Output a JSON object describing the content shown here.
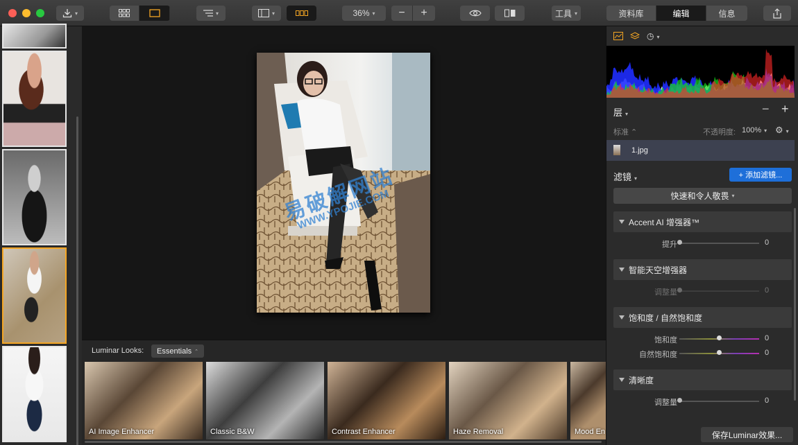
{
  "toolbar": {
    "zoom": "36%",
    "tools_label": "工具",
    "tabs": [
      "资料库",
      "编辑",
      "信息"
    ],
    "active_tab": "编辑"
  },
  "looks": {
    "label": "Luminar Looks:",
    "collection": "Essentials",
    "items": [
      "AI Image Enhancer",
      "Classic B&W",
      "Contrast Enhancer",
      "Haze Removal",
      "Mood En"
    ]
  },
  "panel": {
    "layers_title": "层",
    "blend_mode": "标准",
    "opacity_label": "不透明度:",
    "opacity_value": "100%",
    "layer_name": "1.jpg",
    "filters_title": "滤镜",
    "add_filter": "+ 添加滤镜...",
    "preset": "快速和令人敬畏",
    "filters": [
      {
        "title": "Accent AI 增强器™",
        "sliders": [
          {
            "label": "提升",
            "value": "0"
          }
        ]
      },
      {
        "title": "智能天空增强器",
        "sliders": [
          {
            "label": "调整量",
            "value": "0"
          }
        ]
      },
      {
        "title": "饱和度 / 自然饱和度",
        "sliders": [
          {
            "label": "饱和度",
            "value": "0"
          },
          {
            "label": "自然饱和度",
            "value": "0"
          }
        ]
      },
      {
        "title": "清晰度",
        "sliders": [
          {
            "label": "调整量",
            "value": "0"
          }
        ]
      }
    ],
    "save_button": "保存Luminar效果..."
  },
  "watermark": {
    "line1": "易破解网站",
    "line2": "WWW.YPOJIE.COM"
  },
  "colors": {
    "accent": "#f5a623",
    "blue": "#1e6fd9",
    "selected_layer": "#3d4150"
  }
}
